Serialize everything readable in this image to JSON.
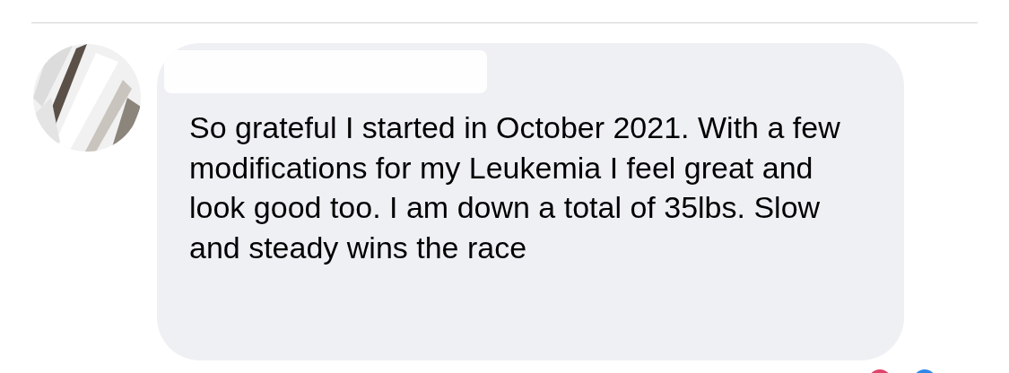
{
  "comment": {
    "text": "So grateful I started in October 2021. With a few modifications for my Leukemia I feel great and look good too. I am down a total of 35lbs. Slow and steady wins the race"
  }
}
